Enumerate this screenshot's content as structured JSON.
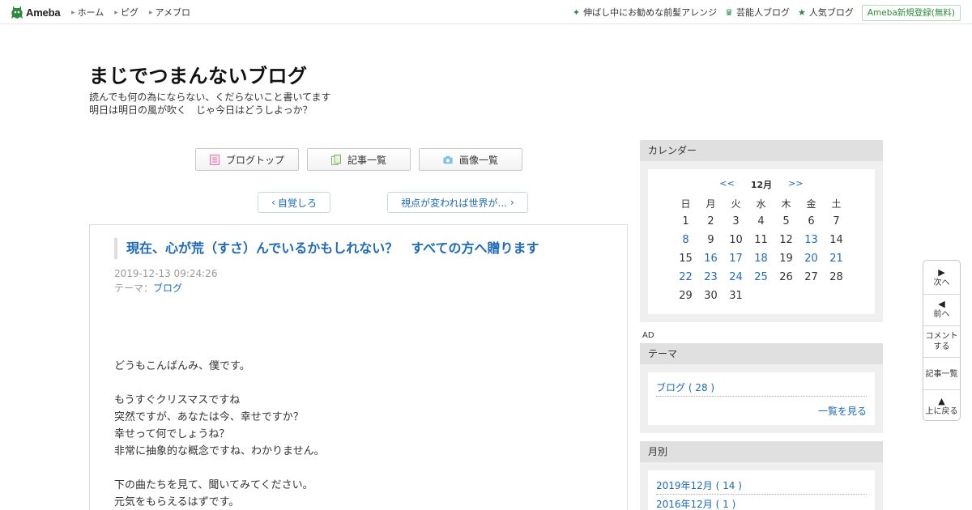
{
  "topbar": {
    "logo_text": "Ameba",
    "nav": [
      "ホーム",
      "ピグ",
      "アメブロ"
    ],
    "links": [
      {
        "icon": "sparkle-icon",
        "label": "伸ばし中にお勧めな前髪アレンジ"
      },
      {
        "icon": "crown-icon",
        "label": "芸能人ブログ"
      },
      {
        "icon": "star-icon",
        "label": "人気ブログ"
      }
    ],
    "signup_label": "Ameba新規登録(無料)",
    "accent": "#2d8c3c"
  },
  "header": {
    "title": "まじでつまんないブログ",
    "description_line1": "読んでも何の為にならない、くだらないこと書いてます",
    "description_line2": "明日は明日の風が吹く　じゃ今日はどうしよっか？"
  },
  "blog_nav": {
    "top_label": "ブログトップ",
    "entries_label": "記事一覧",
    "images_label": "画像一覧"
  },
  "pager": {
    "prev_label": "自覚しろ",
    "next_label": "視点が変われば世界が..."
  },
  "article": {
    "title": "現在、心が荒（すさ）んでいるかもしれない？　すべての方へ贈ります",
    "date": "2019-12-13 09:24:26",
    "theme_prefix": "テーマ：",
    "theme": "ブログ",
    "body": [
      "どうもこんばんみ、僕です。",
      "",
      "もうすぐクリスマスですね",
      "突然ですが、あなたは今、幸せですか？",
      "幸せって何でしょうね？",
      "非常に抽象的な概念ですね、わかりません。",
      "",
      "下の曲たちを見て、聞いてみてください。",
      "元気をもらえるはずです。"
    ]
  },
  "sidebar": {
    "calendar": {
      "heading": "カレンダー",
      "prev": "<<",
      "month": "12月",
      "next": ">>",
      "weekdays": [
        "日",
        "月",
        "火",
        "水",
        "木",
        "金",
        "土"
      ],
      "weeks": [
        [
          "1",
          "2",
          "3",
          "4",
          "5",
          "6",
          "7"
        ],
        [
          "8",
          "9",
          "10",
          "11",
          "12",
          "13",
          "14"
        ],
        [
          "15",
          "16",
          "17",
          "18",
          "19",
          "20",
          "21"
        ],
        [
          "22",
          "23",
          "24",
          "25",
          "26",
          "27",
          "28"
        ],
        [
          "29",
          "30",
          "31",
          "",
          "",
          "",
          ""
        ]
      ],
      "linked_days": [
        "8",
        "13",
        "16",
        "17",
        "18",
        "20",
        "21",
        "22",
        "23",
        "24",
        "25"
      ]
    },
    "ad_label": "AD",
    "themes": {
      "heading": "テーマ",
      "items": [
        "ブログ ( 28 )"
      ],
      "more_label": "一覧を見る"
    },
    "monthly": {
      "heading": "月別",
      "items": [
        "2019年12月 ( 14 )",
        "2016年12月 ( 1 )"
      ]
    }
  },
  "floatmenu": {
    "next": "次へ",
    "prev": "前へ",
    "comment_line1": "コメント",
    "comment_line2": "する",
    "entries": "記事一覧",
    "top": "上に戻る"
  }
}
